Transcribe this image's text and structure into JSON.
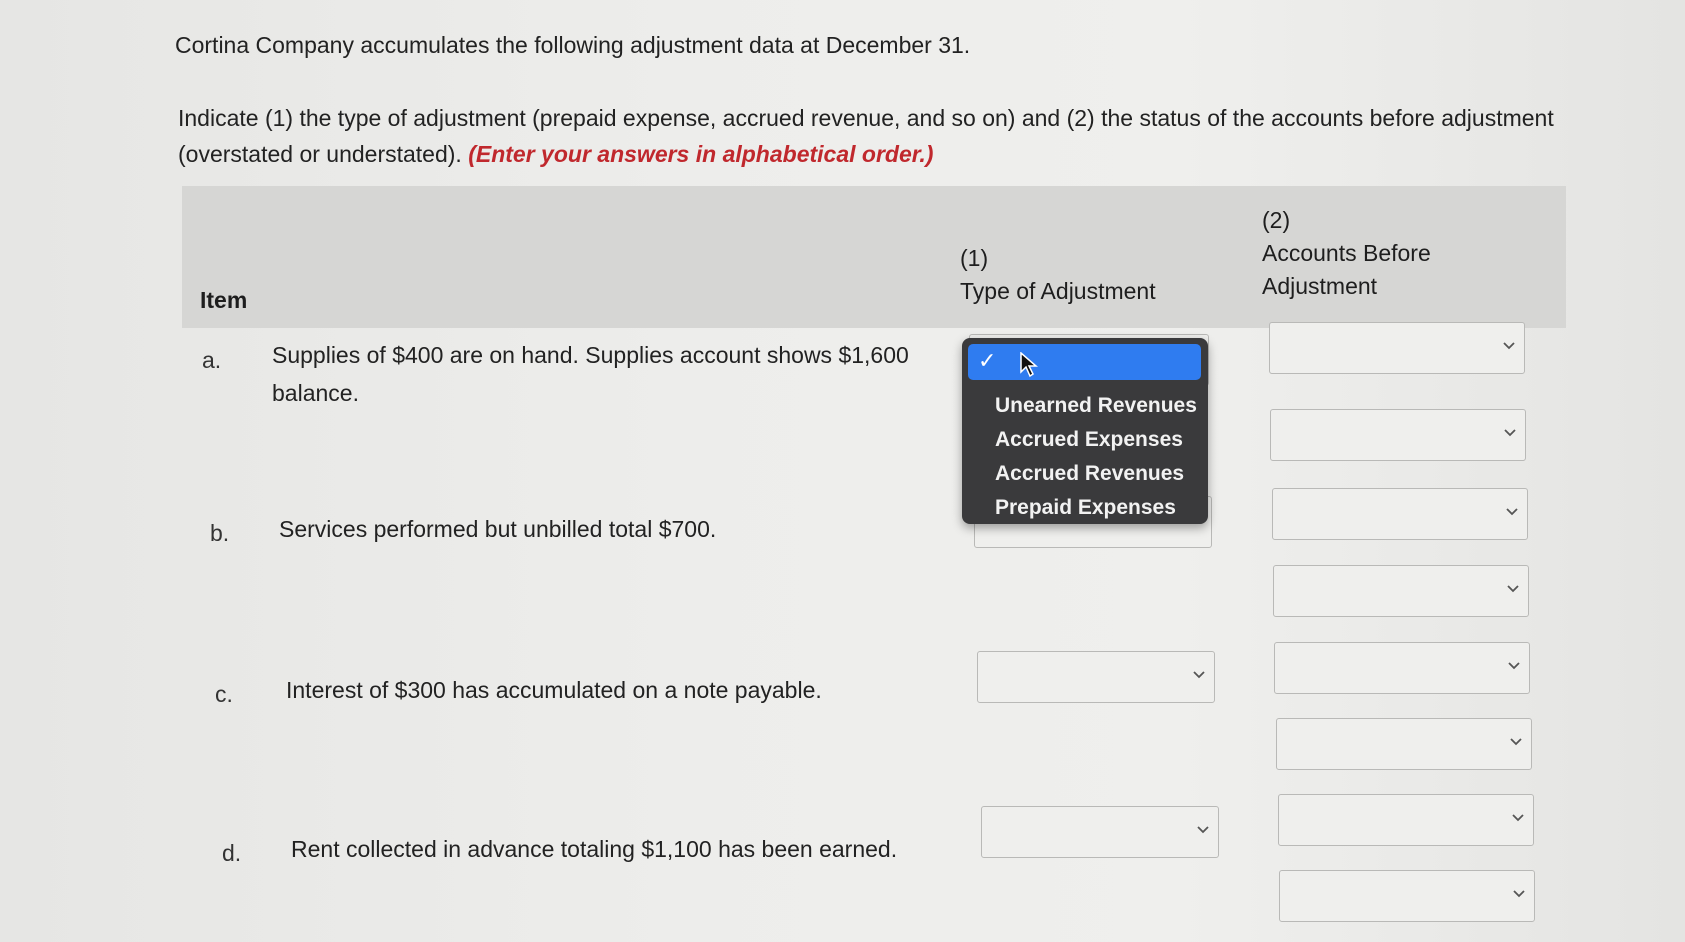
{
  "intro": "Cortina Company accumulates the following adjustment data at December 31.",
  "instructions": {
    "text": "Indicate (1) the type of adjustment (prepaid expense, accrued revenue, and so on) and (2) the status of the accounts before adjustment (overstated or understated).",
    "emphasis": "(Enter your answers in alphabetical order.)"
  },
  "table": {
    "header_item": "Item",
    "header_col1_number": "(1)",
    "header_col1_label": "Type of Adjustment",
    "header_col2_number": "(2)",
    "header_col2_line1": "Accounts Before",
    "header_col2_line2": "Adjustment",
    "rows": [
      {
        "letter": "a.",
        "line1": "Supplies of $400 are on hand. Supplies account shows $1,600",
        "line2": "balance."
      },
      {
        "letter": "b.",
        "line1": "Services performed but unbilled total $700.",
        "line2": ""
      },
      {
        "letter": "c.",
        "line1": "Interest of $300 has accumulated on a note payable.",
        "line2": ""
      },
      {
        "letter": "d.",
        "line1": "Rent collected in advance totaling $1,100 has been earned.",
        "line2": ""
      }
    ]
  },
  "dropdown": {
    "selected_mark": "✓",
    "options": [
      "Unearned Revenues",
      "Accrued Expenses",
      "Accrued Revenues",
      "Prepaid Expenses"
    ]
  },
  "colors": {
    "header_bg": "#d6d6d4",
    "dropdown_bg": "#3a3a3c",
    "highlight": "#2f7cf0",
    "emphasis_red": "#c0282d"
  }
}
